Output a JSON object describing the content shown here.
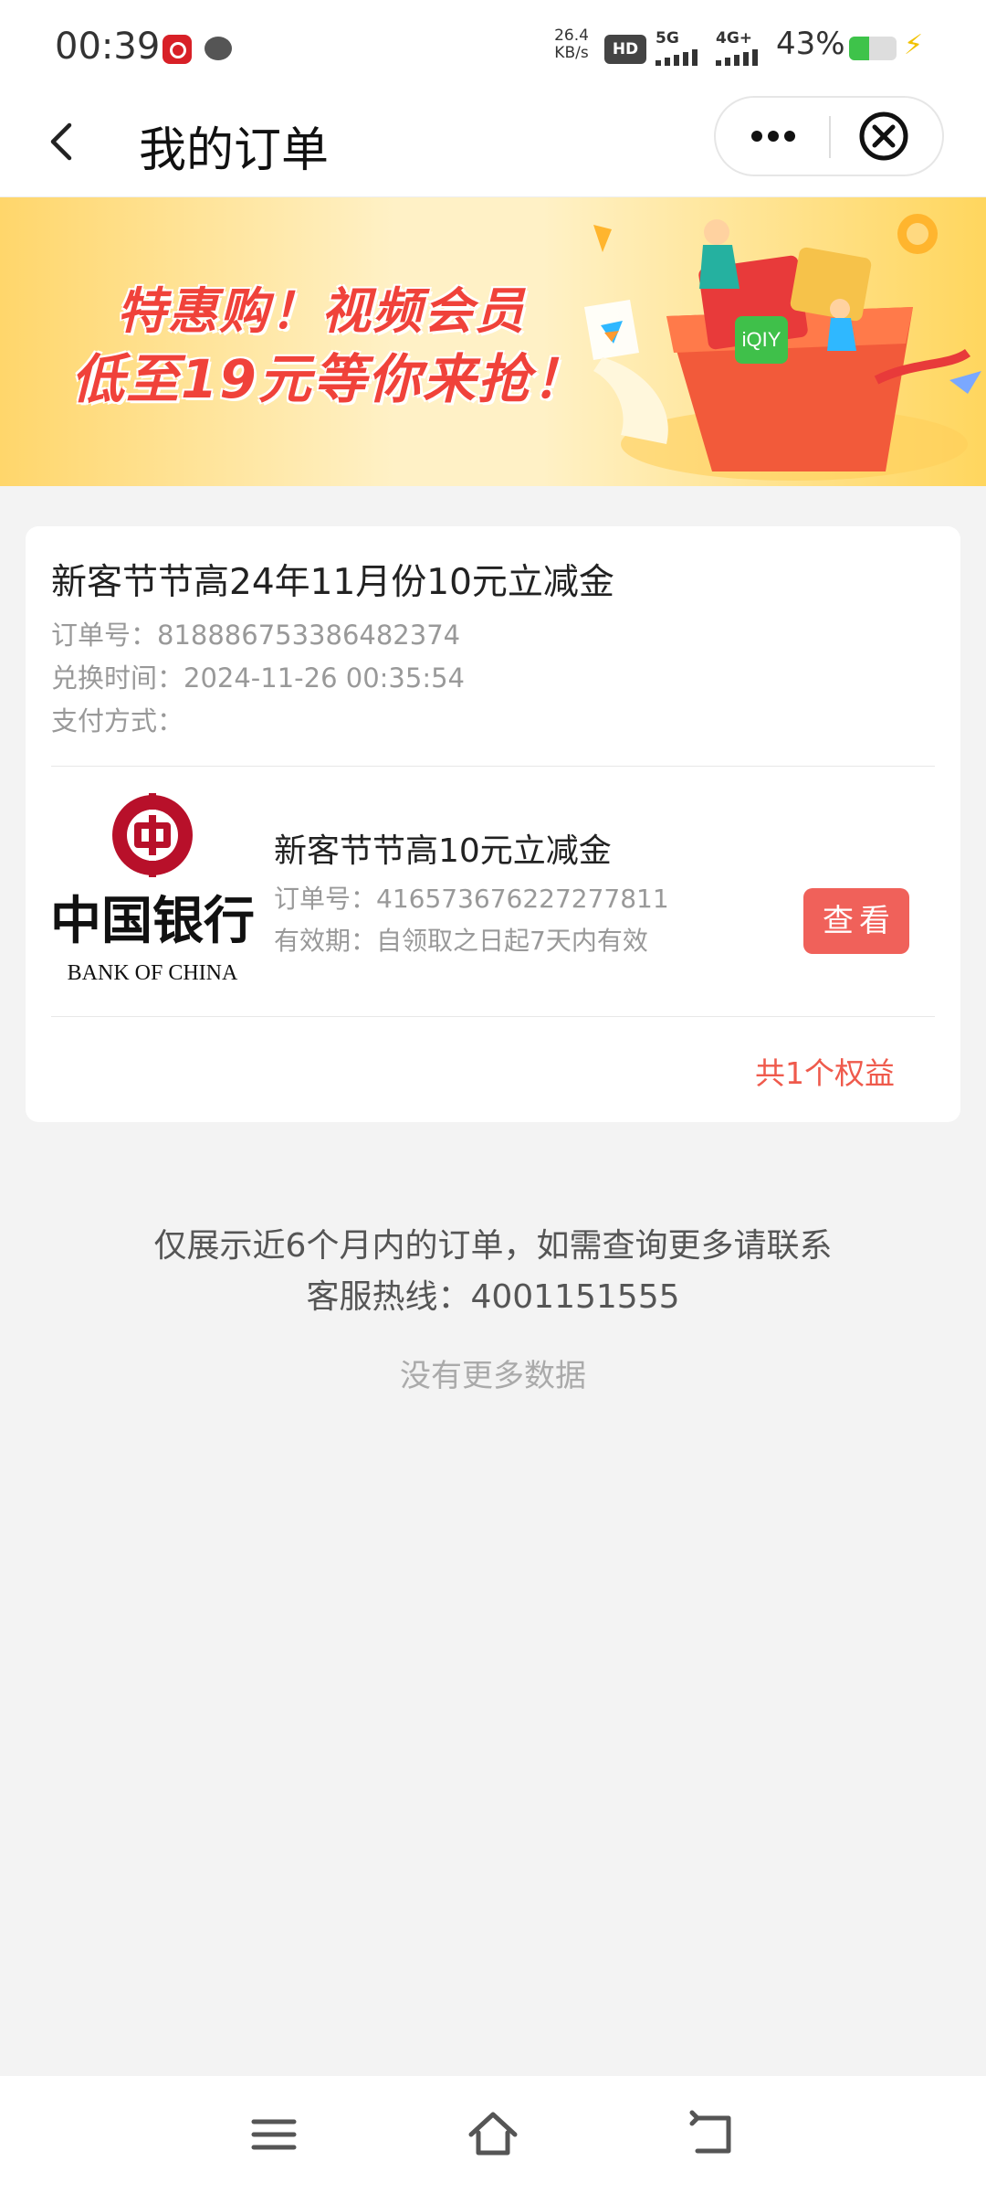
{
  "status_bar": {
    "time": "00:39",
    "net_speed_value": "26.4",
    "net_speed_unit": "KB/s",
    "hd_label": "HD",
    "net_5g": "5G",
    "net_4g": "4G+",
    "battery_percent": "43%",
    "battery_level": 0.43
  },
  "header": {
    "title": "我的订单",
    "more_icon": "more-dots-icon",
    "close_icon": "close-circle-icon"
  },
  "banner": {
    "line1": "特惠购！视频会员",
    "line2": "低至19元等你来抢！"
  },
  "order": {
    "title": "新客节节高24年11月份10元立减金",
    "order_no": "订单号：818886753386482374",
    "exchange_time": "兑换时间：2024-11-26 00:35:54",
    "payment": "支付方式：",
    "item": {
      "logo_text_cn": "中国银行",
      "logo_text_en": "BANK OF CHINA",
      "title": "新客节节高10元立减金",
      "order_no": "订单号：416573676227277811",
      "validity": "有效期：自领取之日起7天内有效",
      "view_label": "查看"
    },
    "total": "共1个权益"
  },
  "footer": {
    "notice_line1": "仅展示近6个月内的订单，如需查询更多请联系",
    "notice_line2": "客服热线：4001151555",
    "no_more": "没有更多数据"
  },
  "colors": {
    "accent_red": "#f0615a",
    "total_red": "#ef5a4c",
    "boc_red": "#b8102a"
  },
  "nav": {
    "icons": [
      "menu-icon",
      "home-icon",
      "back-icon"
    ]
  }
}
